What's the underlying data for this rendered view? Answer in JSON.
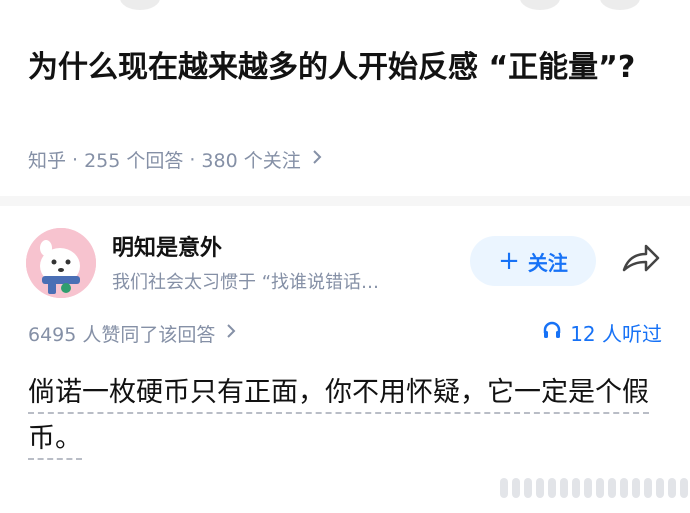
{
  "question": {
    "title": "为什么现在越来越多的人开始反感 “正能量”?",
    "source": "知乎",
    "answers_count": "255 个回答",
    "followers_count": "380 个关注"
  },
  "answer": {
    "author_name": "明知是意外",
    "author_bio": "我们社会太习惯于 “找谁说错话…",
    "follow_label": "关注",
    "agree_text": "6495 人赞同了该回答",
    "listen_text": "12 人听过",
    "content": "倘诺一枚硬币只有正面，你不用怀疑，它一定是个假币。"
  },
  "icons": {
    "share": "share-icon",
    "headphones": "headphones-icon",
    "chevron": "chevron-right-icon"
  },
  "colors": {
    "accent": "#1772f6",
    "meta": "#8590a6",
    "follow_bg": "#ebf5ff",
    "avatar_bg": "#f7c3cf"
  }
}
